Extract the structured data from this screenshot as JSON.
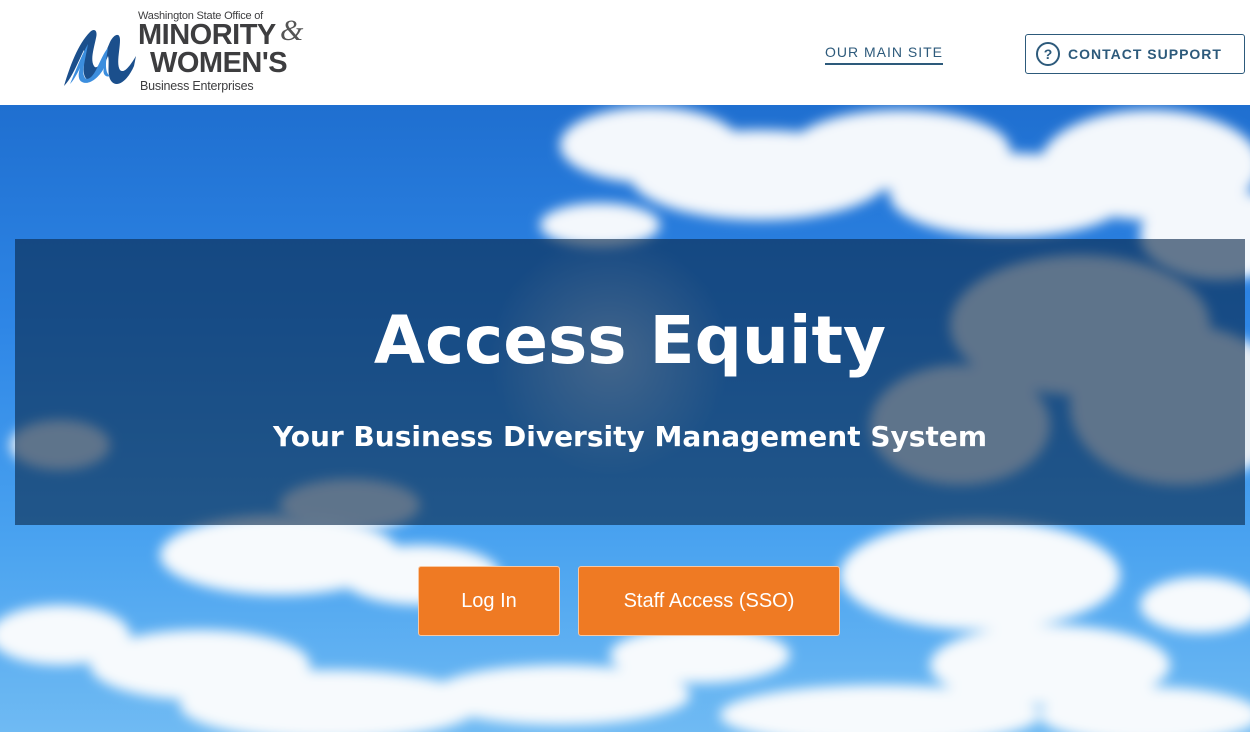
{
  "header": {
    "logo": {
      "line1": "Washington State Office of",
      "line2": "MINORITY",
      "ampersand": "&",
      "line3": "WOMEN'S",
      "line4": "Business Enterprises",
      "icon": "omwbe-wave-logo",
      "colors": {
        "mark_dark": "#1b4f8c",
        "mark_light": "#3c8ede",
        "text": "#3d3d3f"
      }
    },
    "nav": {
      "main_site_label": "OUR MAIN SITE",
      "support_label": "CONTACT SUPPORT",
      "support_icon": "question-circle-icon",
      "support_icon_glyph": "?"
    },
    "colors": {
      "link": "#2d5a7b"
    }
  },
  "hero": {
    "title": "Access Equity",
    "subtitle": "Your Business Diversity Management System",
    "background": "sky-clouds-image",
    "buttons": {
      "login_label": "Log In",
      "sso_label": "Staff Access (SSO)"
    },
    "colors": {
      "button": "#ef7a23",
      "overlay": "rgba(10, 40, 75, 0.62)"
    }
  }
}
